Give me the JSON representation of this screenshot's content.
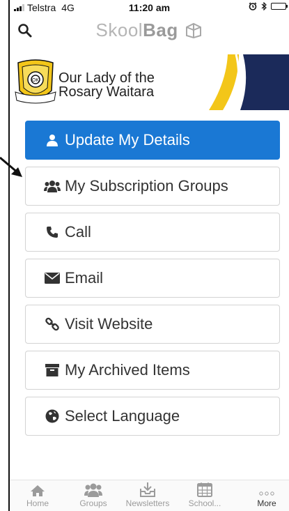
{
  "status_bar": {
    "carrier": "Telstra",
    "network": "4G",
    "time": "11:20 am"
  },
  "header": {
    "brand_light": "Skool",
    "brand_bold": "Bag"
  },
  "banner": {
    "school_line1": "Our Lady of the",
    "school_line2": "Rosary Waitara",
    "crest_top_text": "WAITARA",
    "crest_bottom_text": "SOLI DEO"
  },
  "menu": {
    "items": [
      {
        "label": "Update My Details",
        "icon": "user-icon"
      },
      {
        "label": "My Subscription Groups",
        "icon": "users-icon"
      },
      {
        "label": "Call",
        "icon": "phone-icon"
      },
      {
        "label": "Email",
        "icon": "envelope-icon"
      },
      {
        "label": "Visit Website",
        "icon": "link-icon"
      },
      {
        "label": "My Archived Items",
        "icon": "archive-icon"
      },
      {
        "label": "Select Language",
        "icon": "globe-icon"
      }
    ]
  },
  "tab_bar": {
    "tabs": [
      {
        "label": "Home",
        "icon": "home-icon"
      },
      {
        "label": "Groups",
        "icon": "groups-icon"
      },
      {
        "label": "Newsletters",
        "icon": "newsletters-icon"
      },
      {
        "label": "School...",
        "icon": "calendar-icon"
      },
      {
        "label": "More",
        "icon": "more-icon"
      }
    ],
    "active": "More"
  },
  "colors": {
    "primary": "#1a78d4",
    "banner_yellow": "#f3c619",
    "banner_navy": "#1b2a5a"
  }
}
